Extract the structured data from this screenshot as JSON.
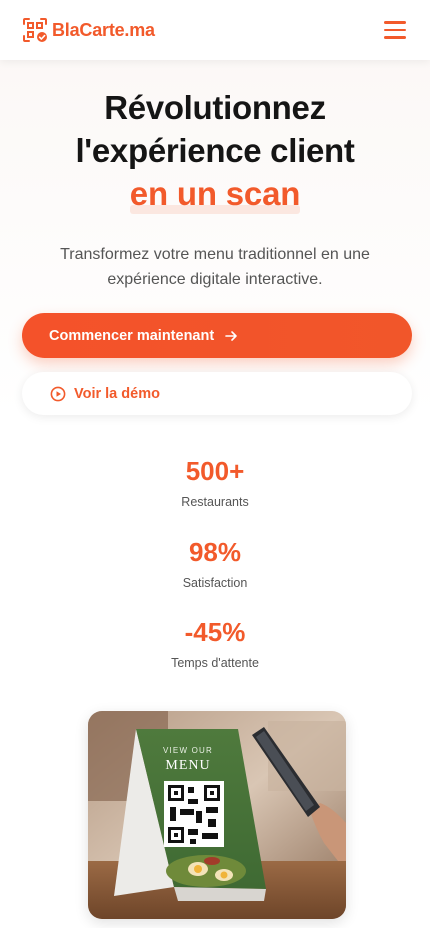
{
  "header": {
    "brand_name": "BlaCarte.ma",
    "logo_icon": "qr-code-check-icon",
    "menu_icon": "hamburger-menu-icon"
  },
  "hero": {
    "title_line1": "Révolutionnez",
    "title_line2": "l'expérience client",
    "title_accent": "en un scan",
    "subtitle": "Transformez votre menu traditionnel en une expérience digitale interactive."
  },
  "actions": {
    "primary_label": "Commencer maintenant",
    "primary_icon": "arrow-right-icon",
    "secondary_label": "Voir la démo",
    "secondary_icon": "play-circle-icon"
  },
  "stats": [
    {
      "value": "500+",
      "label": "Restaurants"
    },
    {
      "value": "98%",
      "label": "Satisfaction"
    },
    {
      "value": "-45%",
      "label": "Temps d'attente"
    }
  ],
  "image": {
    "tent_card_top": "VIEW OUR",
    "tent_card_title": "MENU"
  },
  "colors": {
    "accent": "#f25a2b",
    "text": "#151515",
    "muted": "#555555"
  }
}
